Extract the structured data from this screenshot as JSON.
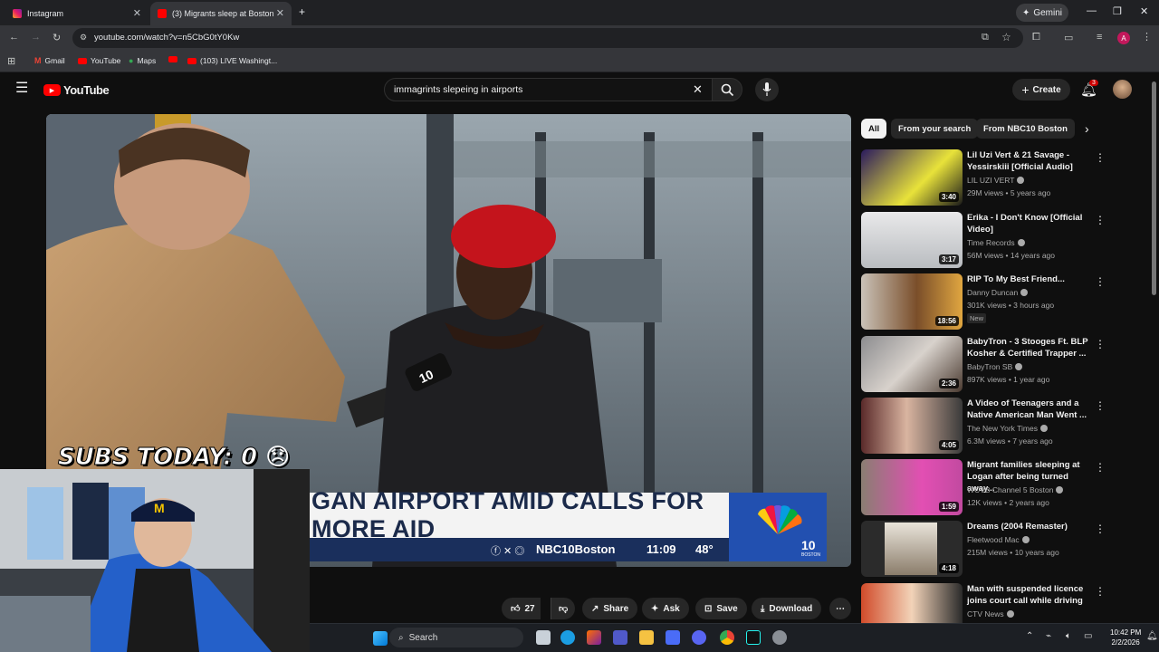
{
  "browser": {
    "tabs": [
      {
        "label": "Instagram",
        "active": false
      },
      {
        "label": "(3) Migrants sleep at Boston Lo",
        "active": true
      }
    ],
    "gemini_label": "Gemini",
    "url": "youtube.com/watch?v=n5CbG0tY0Kw",
    "bookmarks": [
      "Gmail",
      "YouTube",
      "Maps",
      "(103) LIVE Washingt..."
    ],
    "profile_initial": "A"
  },
  "youtube": {
    "logo": "YouTube",
    "search_query": "immagrints slepeing in airports",
    "create_label": "Create",
    "notifications_count": "3"
  },
  "video": {
    "lower_third_text": "GAN AIRPORT AMID CALLS FOR MORE AID",
    "handle": "NBC10Boston",
    "time": "11:09",
    "temp": "48°",
    "station": "10",
    "station_sub": "BOSTON",
    "mic_flag": "10"
  },
  "overlay": {
    "subs_text": "SUBS TODAY: 0"
  },
  "actions": {
    "likes": "27",
    "share": "Share",
    "ask": "Ask",
    "save": "Save",
    "download": "Download"
  },
  "chips": [
    "All",
    "From your search",
    "From NBC10 Boston"
  ],
  "recommendations": [
    {
      "title": "Lil Uzi Vert & 21 Savage - Yessirskiii [Official Audio]",
      "channel": "LIL UZI VERT",
      "meta": "29M views • 5 years ago",
      "duration": "3:40",
      "verified": true
    },
    {
      "title": "Erika - I Don't Know [Official Video]",
      "channel": "Time Records",
      "meta": "56M views • 14 years ago",
      "duration": "3:17",
      "verified": true
    },
    {
      "title": "RIP To My Best Friend...",
      "channel": "Danny Duncan",
      "meta": "301K views • 3 hours ago",
      "duration": "18:56",
      "verified": true,
      "badge": "New"
    },
    {
      "title": "BabyTron - 3 Stooges Ft. BLP Kosher & Certified Trapper ...",
      "channel": "BabyTron SB",
      "meta": "897K views • 1 year ago",
      "duration": "2:36",
      "verified": true
    },
    {
      "title": "A Video of Teenagers and a Native American Man Went ...",
      "channel": "The New York Times",
      "meta": "6.3M views • 7 years ago",
      "duration": "4:05",
      "verified": true
    },
    {
      "title": "Migrant families sleeping at Logan after being turned away...",
      "channel": "WCVB Channel 5 Boston",
      "meta": "12K views • 2 years ago",
      "duration": "1:59",
      "verified": true
    },
    {
      "title": "Dreams (2004 Remaster)",
      "channel": "Fleetwood Mac",
      "meta": "215M views • 10 years ago",
      "duration": "4:18",
      "verified": true
    },
    {
      "title": "Man with suspended licence joins court call while driving",
      "channel": "CTV News",
      "meta": "",
      "duration": "",
      "verified": true
    }
  ],
  "taskbar": {
    "search_label": "Search",
    "time": "10:42 PM",
    "date": "2/2/2026"
  }
}
